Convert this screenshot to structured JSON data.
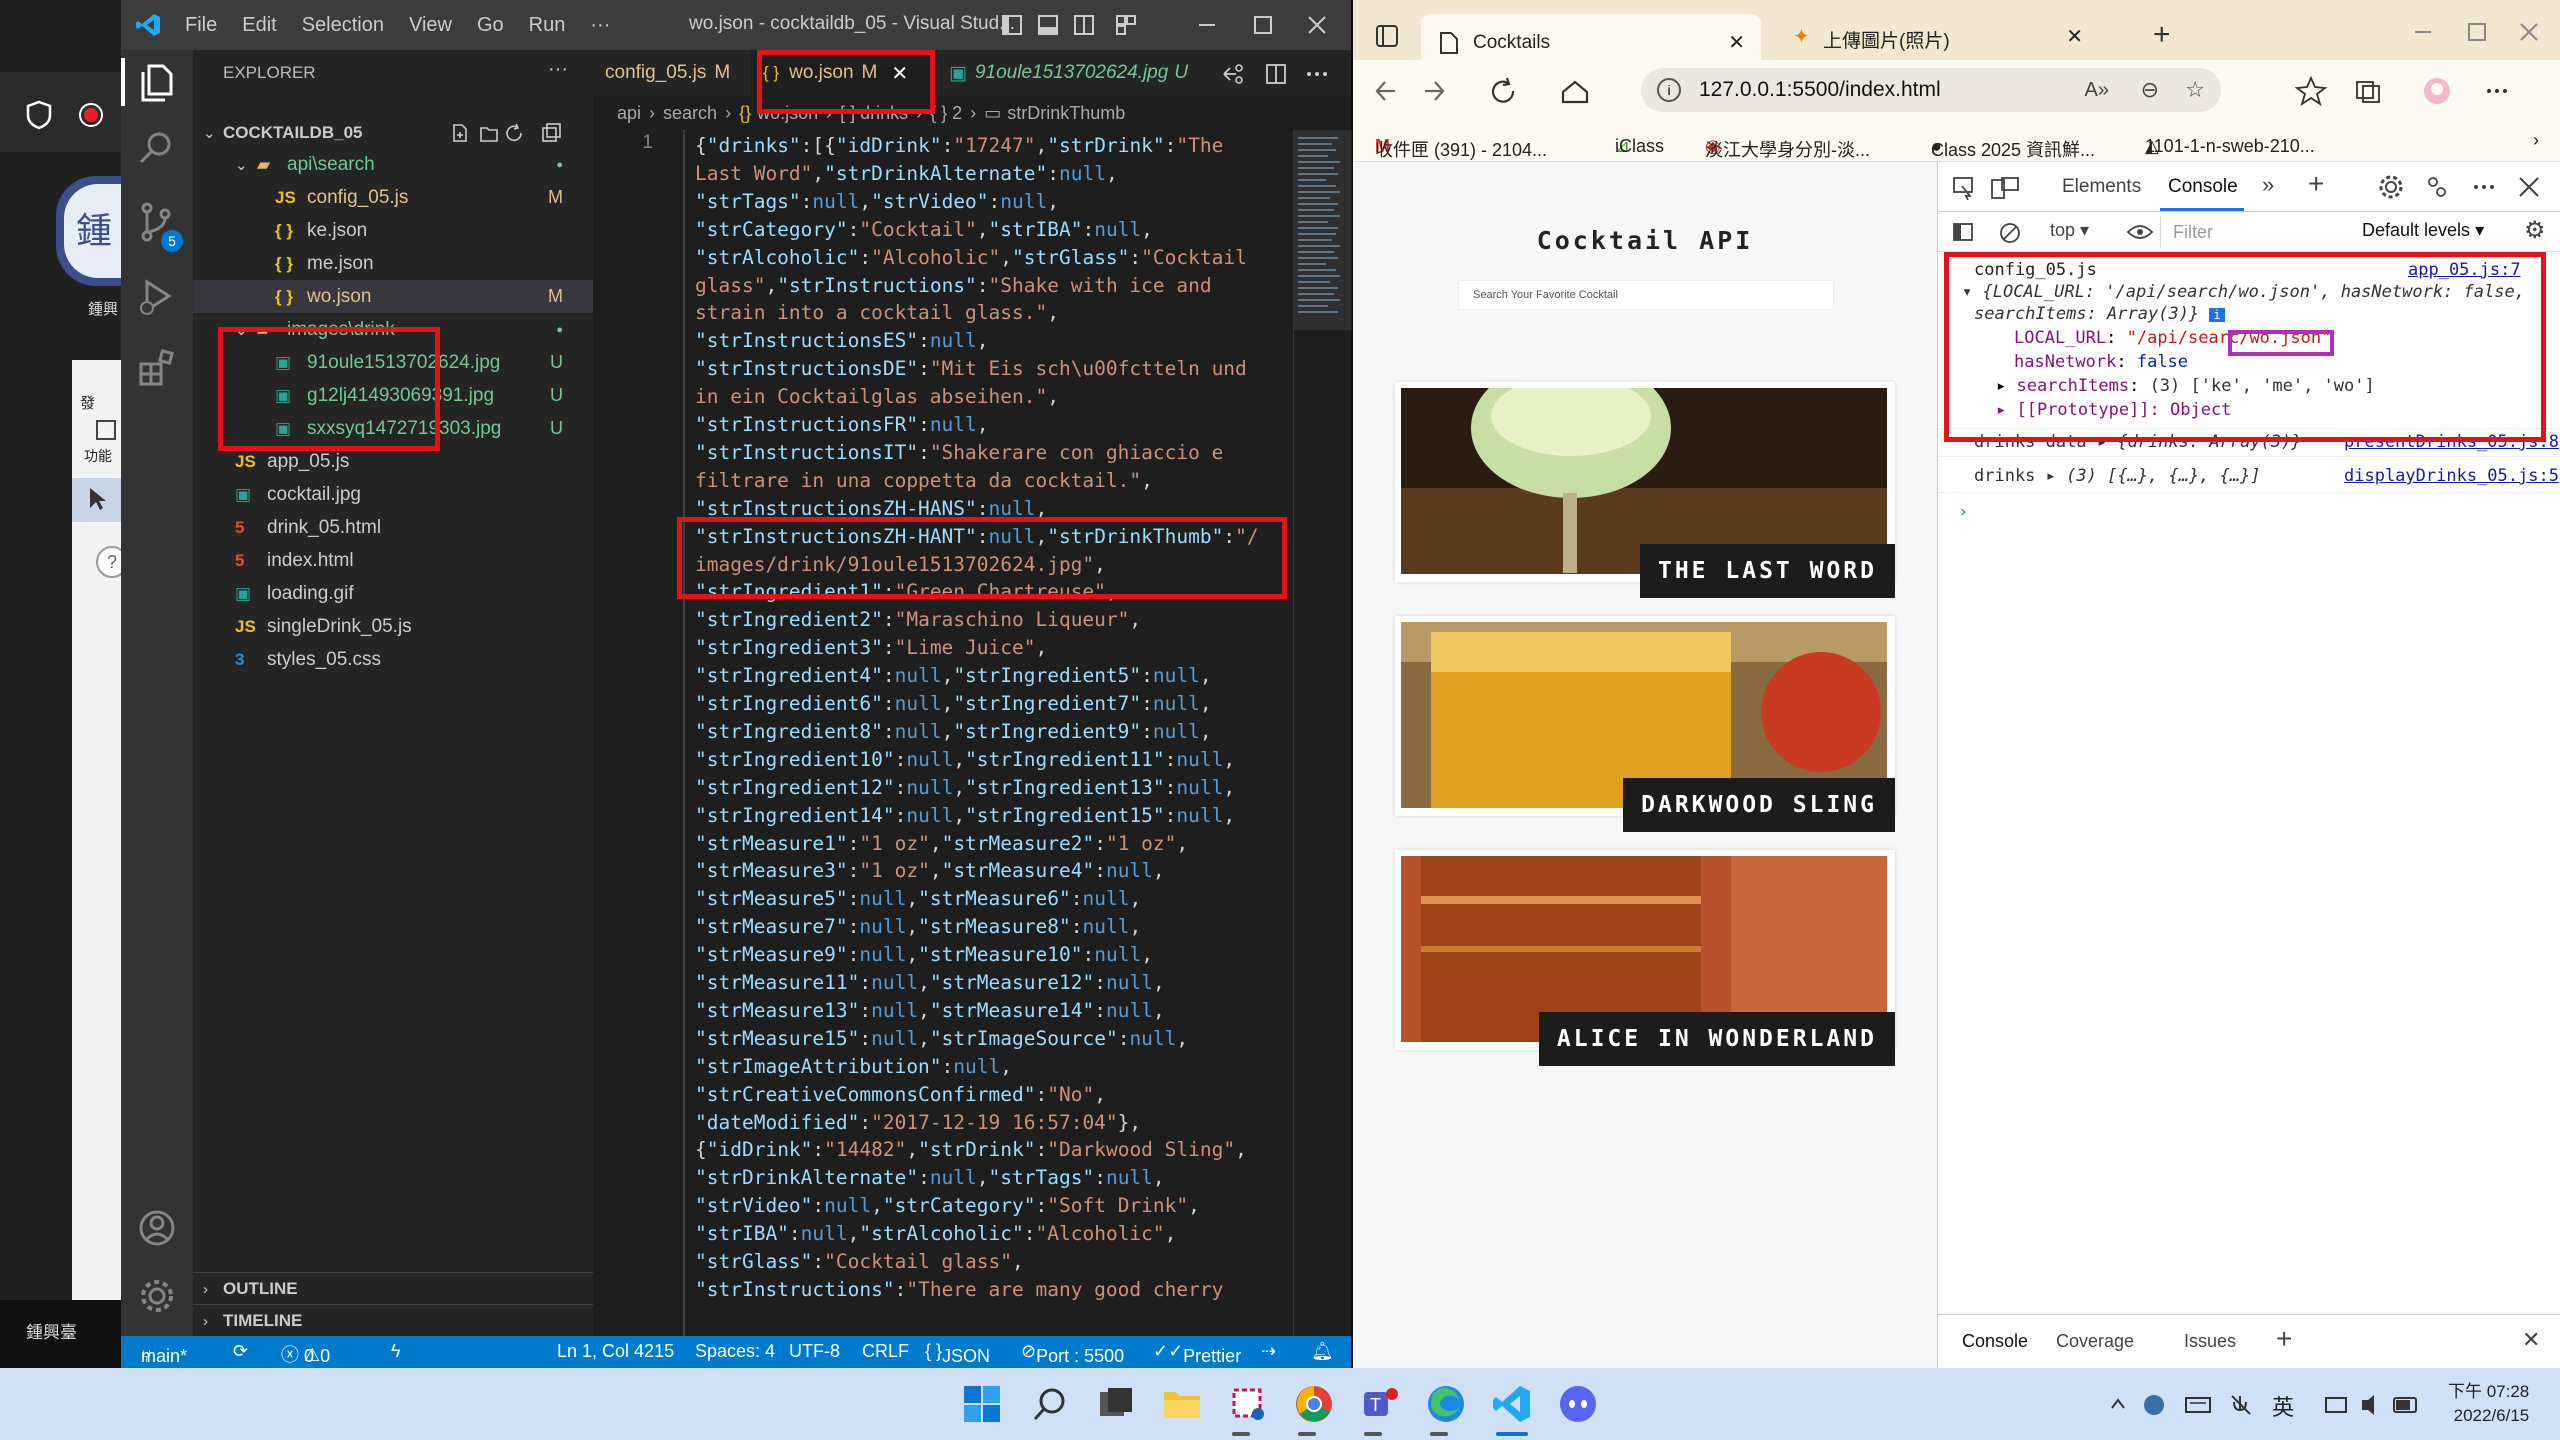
{
  "bgapp": {
    "char": "鍾",
    "small_label": "鍾興",
    "menu_label": "發",
    "func_label": "功能",
    "bottom_label": "鍾興臺"
  },
  "vscode": {
    "menu": [
      "File",
      "Edit",
      "Selection",
      "View",
      "Go",
      "Run",
      "···"
    ],
    "window_title": "wo.json - cocktaildb_05 - Visual Stud...",
    "scm_badge": "5",
    "explorer": {
      "header": "EXPLORER",
      "root": "COCKTAILDB_05",
      "items": [
        {
          "name": "api\\search",
          "type": "folder",
          "status": "●"
        },
        {
          "name": "config_05.js",
          "type": "js",
          "status": "M"
        },
        {
          "name": "ke.json",
          "type": "json",
          "status": ""
        },
        {
          "name": "me.json",
          "type": "json",
          "status": ""
        },
        {
          "name": "wo.json",
          "type": "json",
          "status": "M"
        },
        {
          "name": "images\\drink",
          "type": "folder",
          "status": "●"
        },
        {
          "name": "91oule1513702624.jpg",
          "type": "img",
          "status": "U"
        },
        {
          "name": "g12lj41493069391.jpg",
          "type": "img",
          "status": "U"
        },
        {
          "name": "sxxsyq1472719303.jpg",
          "type": "img",
          "status": "U"
        },
        {
          "name": "app_05.js",
          "type": "js",
          "status": ""
        },
        {
          "name": "cocktail.jpg",
          "type": "img",
          "status": ""
        },
        {
          "name": "drink_05.html",
          "type": "html",
          "status": ""
        },
        {
          "name": "index.html",
          "type": "html",
          "status": ""
        },
        {
          "name": "loading.gif",
          "type": "img",
          "status": ""
        },
        {
          "name": "singleDrink_05.js",
          "type": "js",
          "status": ""
        },
        {
          "name": "styles_05.css",
          "type": "css",
          "status": ""
        }
      ],
      "outline": "OUTLINE",
      "timeline": "TIMELINE"
    },
    "tabs": [
      {
        "label": "config_05.js",
        "status": "M"
      },
      {
        "label": "wo.json",
        "status": "M"
      },
      {
        "label": "91oule1513702624.jpg",
        "status": "U"
      }
    ],
    "breadcrumb": [
      "api",
      "search",
      "wo.json",
      "[ ] drinks",
      "{ } 2",
      "strDrinkThumb"
    ],
    "line_number": "1",
    "code": [
      [
        [
          "p",
          "{"
        ],
        [
          "k",
          "\"drinks\""
        ],
        [
          "p",
          ":[{"
        ],
        [
          "k",
          "\"idDrink\""
        ],
        [
          "p",
          ":"
        ],
        [
          "s",
          "\"17247\""
        ],
        [
          "p",
          ","
        ],
        [
          "k",
          "\"strDrink\""
        ],
        [
          "p",
          ":"
        ],
        [
          "s",
          "\"The"
        ]
      ],
      [
        [
          "s",
          "Last Word\""
        ],
        [
          "p",
          ","
        ],
        [
          "k",
          "\"strDrinkAlternate\""
        ],
        [
          "p",
          ":"
        ],
        [
          "n",
          "null"
        ],
        [
          "p",
          ","
        ]
      ],
      [
        [
          "k",
          "\"strTags\""
        ],
        [
          "p",
          ":"
        ],
        [
          "n",
          "null"
        ],
        [
          "p",
          ","
        ],
        [
          "k",
          "\"strVideo\""
        ],
        [
          "p",
          ":"
        ],
        [
          "n",
          "null"
        ],
        [
          "p",
          ","
        ]
      ],
      [
        [
          "k",
          "\"strCategory\""
        ],
        [
          "p",
          ":"
        ],
        [
          "s",
          "\"Cocktail\""
        ],
        [
          "p",
          ","
        ],
        [
          "k",
          "\"strIBA\""
        ],
        [
          "p",
          ":"
        ],
        [
          "n",
          "null"
        ],
        [
          "p",
          ","
        ]
      ],
      [
        [
          "k",
          "\"strAlcoholic\""
        ],
        [
          "p",
          ":"
        ],
        [
          "s",
          "\"Alcoholic\""
        ],
        [
          "p",
          ","
        ],
        [
          "k",
          "\"strGlass\""
        ],
        [
          "p",
          ":"
        ],
        [
          "s",
          "\"Cocktail"
        ]
      ],
      [
        [
          "s",
          "glass\""
        ],
        [
          "p",
          ","
        ],
        [
          "k",
          "\"strInstructions\""
        ],
        [
          "p",
          ":"
        ],
        [
          "s",
          "\"Shake with ice and"
        ]
      ],
      [
        [
          "s",
          "strain into a cocktail glass.\""
        ],
        [
          "p",
          ","
        ]
      ],
      [
        [
          "k",
          "\"strInstructionsES\""
        ],
        [
          "p",
          ":"
        ],
        [
          "n",
          "null"
        ],
        [
          "p",
          ","
        ]
      ],
      [
        [
          "k",
          "\"strInstructionsDE\""
        ],
        [
          "p",
          ":"
        ],
        [
          "s",
          "\"Mit Eis sch\\u00fctteln und"
        ]
      ],
      [
        [
          "s",
          "in ein Cocktailglas abseihen.\""
        ],
        [
          "p",
          ","
        ]
      ],
      [
        [
          "k",
          "\"strInstructionsFR\""
        ],
        [
          "p",
          ":"
        ],
        [
          "n",
          "null"
        ],
        [
          "p",
          ","
        ]
      ],
      [
        [
          "k",
          "\"strInstructionsIT\""
        ],
        [
          "p",
          ":"
        ],
        [
          "s",
          "\"Shakerare con ghiaccio e"
        ]
      ],
      [
        [
          "s",
          "filtrare in una coppetta da cocktail.\""
        ],
        [
          "p",
          ","
        ]
      ],
      [
        [
          "k",
          "\"strInstructionsZH-HANS\""
        ],
        [
          "p",
          ":"
        ],
        [
          "n",
          "null"
        ],
        [
          "p",
          ","
        ]
      ],
      [
        [
          "k",
          "\"strInstructionsZH-HANT\""
        ],
        [
          "p",
          ":"
        ],
        [
          "n",
          "null"
        ],
        [
          "p",
          ","
        ],
        [
          "k",
          "\"strDrinkThumb\""
        ],
        [
          "p",
          ":"
        ],
        [
          "s",
          "\"/"
        ]
      ],
      [
        [
          "s",
          "images/drink/91oule1513702624.jpg\""
        ],
        [
          "p",
          ","
        ]
      ],
      [
        [
          "k",
          "\"strIngredient1\""
        ],
        [
          "p",
          ":"
        ],
        [
          "s",
          "\"Green Chartreuse\""
        ],
        [
          "p",
          ","
        ]
      ],
      [
        [
          "k",
          "\"strIngredient2\""
        ],
        [
          "p",
          ":"
        ],
        [
          "s",
          "\"Maraschino Liqueur\""
        ],
        [
          "p",
          ","
        ]
      ],
      [
        [
          "k",
          "\"strIngredient3\""
        ],
        [
          "p",
          ":"
        ],
        [
          "s",
          "\"Lime Juice\""
        ],
        [
          "p",
          ","
        ]
      ],
      [
        [
          "k",
          "\"strIngredient4\""
        ],
        [
          "p",
          ":"
        ],
        [
          "n",
          "null"
        ],
        [
          "p",
          ","
        ],
        [
          "k",
          "\"strIngredient5\""
        ],
        [
          "p",
          ":"
        ],
        [
          "n",
          "null"
        ],
        [
          "p",
          ","
        ]
      ],
      [
        [
          "k",
          "\"strIngredient6\""
        ],
        [
          "p",
          ":"
        ],
        [
          "n",
          "null"
        ],
        [
          "p",
          ","
        ],
        [
          "k",
          "\"strIngredient7\""
        ],
        [
          "p",
          ":"
        ],
        [
          "n",
          "null"
        ],
        [
          "p",
          ","
        ]
      ],
      [
        [
          "k",
          "\"strIngredient8\""
        ],
        [
          "p",
          ":"
        ],
        [
          "n",
          "null"
        ],
        [
          "p",
          ","
        ],
        [
          "k",
          "\"strIngredient9\""
        ],
        [
          "p",
          ":"
        ],
        [
          "n",
          "null"
        ],
        [
          "p",
          ","
        ]
      ],
      [
        [
          "k",
          "\"strIngredient10\""
        ],
        [
          "p",
          ":"
        ],
        [
          "n",
          "null"
        ],
        [
          "p",
          ","
        ],
        [
          "k",
          "\"strIngredient11\""
        ],
        [
          "p",
          ":"
        ],
        [
          "n",
          "null"
        ],
        [
          "p",
          ","
        ]
      ],
      [
        [
          "k",
          "\"strIngredient12\""
        ],
        [
          "p",
          ":"
        ],
        [
          "n",
          "null"
        ],
        [
          "p",
          ","
        ],
        [
          "k",
          "\"strIngredient13\""
        ],
        [
          "p",
          ":"
        ],
        [
          "n",
          "null"
        ],
        [
          "p",
          ","
        ]
      ],
      [
        [
          "k",
          "\"strIngredient14\""
        ],
        [
          "p",
          ":"
        ],
        [
          "n",
          "null"
        ],
        [
          "p",
          ","
        ],
        [
          "k",
          "\"strIngredient15\""
        ],
        [
          "p",
          ":"
        ],
        [
          "n",
          "null"
        ],
        [
          "p",
          ","
        ]
      ],
      [
        [
          "k",
          "\"strMeasure1\""
        ],
        [
          "p",
          ":"
        ],
        [
          "s",
          "\"1 oz\""
        ],
        [
          "p",
          ","
        ],
        [
          "k",
          "\"strMeasure2\""
        ],
        [
          "p",
          ":"
        ],
        [
          "s",
          "\"1 oz\""
        ],
        [
          "p",
          ","
        ]
      ],
      [
        [
          "k",
          "\"strMeasure3\""
        ],
        [
          "p",
          ":"
        ],
        [
          "s",
          "\"1 oz\""
        ],
        [
          "p",
          ","
        ],
        [
          "k",
          "\"strMeasure4\""
        ],
        [
          "p",
          ":"
        ],
        [
          "n",
          "null"
        ],
        [
          "p",
          ","
        ]
      ],
      [
        [
          "k",
          "\"strMeasure5\""
        ],
        [
          "p",
          ":"
        ],
        [
          "n",
          "null"
        ],
        [
          "p",
          ","
        ],
        [
          "k",
          "\"strMeasure6\""
        ],
        [
          "p",
          ":"
        ],
        [
          "n",
          "null"
        ],
        [
          "p",
          ","
        ]
      ],
      [
        [
          "k",
          "\"strMeasure7\""
        ],
        [
          "p",
          ":"
        ],
        [
          "n",
          "null"
        ],
        [
          "p",
          ","
        ],
        [
          "k",
          "\"strMeasure8\""
        ],
        [
          "p",
          ":"
        ],
        [
          "n",
          "null"
        ],
        [
          "p",
          ","
        ]
      ],
      [
        [
          "k",
          "\"strMeasure9\""
        ],
        [
          "p",
          ":"
        ],
        [
          "n",
          "null"
        ],
        [
          "p",
          ","
        ],
        [
          "k",
          "\"strMeasure10\""
        ],
        [
          "p",
          ":"
        ],
        [
          "n",
          "null"
        ],
        [
          "p",
          ","
        ]
      ],
      [
        [
          "k",
          "\"strMeasure11\""
        ],
        [
          "p",
          ":"
        ],
        [
          "n",
          "null"
        ],
        [
          "p",
          ","
        ],
        [
          "k",
          "\"strMeasure12\""
        ],
        [
          "p",
          ":"
        ],
        [
          "n",
          "null"
        ],
        [
          "p",
          ","
        ]
      ],
      [
        [
          "k",
          "\"strMeasure13\""
        ],
        [
          "p",
          ":"
        ],
        [
          "n",
          "null"
        ],
        [
          "p",
          ","
        ],
        [
          "k",
          "\"strMeasure14\""
        ],
        [
          "p",
          ":"
        ],
        [
          "n",
          "null"
        ],
        [
          "p",
          ","
        ]
      ],
      [
        [
          "k",
          "\"strMeasure15\""
        ],
        [
          "p",
          ":"
        ],
        [
          "n",
          "null"
        ],
        [
          "p",
          ","
        ],
        [
          "k",
          "\"strImageSource\""
        ],
        [
          "p",
          ":"
        ],
        [
          "n",
          "null"
        ],
        [
          "p",
          ","
        ]
      ],
      [
        [
          "k",
          "\"strImageAttribution\""
        ],
        [
          "p",
          ":"
        ],
        [
          "n",
          "null"
        ],
        [
          "p",
          ","
        ]
      ],
      [
        [
          "k",
          "\"strCreativeCommonsConfirmed\""
        ],
        [
          "p",
          ":"
        ],
        [
          "s",
          "\"No\""
        ],
        [
          "p",
          ","
        ]
      ],
      [
        [
          "k",
          "\"dateModified\""
        ],
        [
          "p",
          ":"
        ],
        [
          "s",
          "\"2017-12-19 16:57:04\""
        ],
        [
          "p",
          "},"
        ]
      ],
      [
        [
          "p",
          "{"
        ],
        [
          "k",
          "\"idDrink\""
        ],
        [
          "p",
          ":"
        ],
        [
          "s",
          "\"14482\""
        ],
        [
          "p",
          ","
        ],
        [
          "k",
          "\"strDrink\""
        ],
        [
          "p",
          ":"
        ],
        [
          "s",
          "\"Darkwood Sling\""
        ],
        [
          "p",
          ","
        ]
      ],
      [
        [
          "k",
          "\"strDrinkAlternate\""
        ],
        [
          "p",
          ":"
        ],
        [
          "n",
          "null"
        ],
        [
          "p",
          ","
        ],
        [
          "k",
          "\"strTags\""
        ],
        [
          "p",
          ":"
        ],
        [
          "n",
          "null"
        ],
        [
          "p",
          ","
        ]
      ],
      [
        [
          "k",
          "\"strVideo\""
        ],
        [
          "p",
          ":"
        ],
        [
          "n",
          "null"
        ],
        [
          "p",
          ","
        ],
        [
          "k",
          "\"strCategory\""
        ],
        [
          "p",
          ":"
        ],
        [
          "s",
          "\"Soft Drink\""
        ],
        [
          "p",
          ","
        ]
      ],
      [
        [
          "k",
          "\"strIBA\""
        ],
        [
          "p",
          ":"
        ],
        [
          "n",
          "null"
        ],
        [
          "p",
          ","
        ],
        [
          "k",
          "\"strAlcoholic\""
        ],
        [
          "p",
          ":"
        ],
        [
          "s",
          "\"Alcoholic\""
        ],
        [
          "p",
          ","
        ]
      ],
      [
        [
          "k",
          "\"strGlass\""
        ],
        [
          "p",
          ":"
        ],
        [
          "s",
          "\"Cocktail glass\""
        ],
        [
          "p",
          ","
        ]
      ],
      [
        [
          "k",
          "\"strInstructions\""
        ],
        [
          "p",
          ":"
        ],
        [
          "s",
          "\"There are many good cherry"
        ]
      ]
    ],
    "status_bar": {
      "branch": "main*",
      "errors": "0",
      "warnings": "0",
      "position": "Ln 1, Col 4215",
      "spaces": "Spaces: 4",
      "encoding": "UTF-8",
      "eol": "CRLF",
      "language": "JSON",
      "port": "Port : 5500",
      "prettier": "Prettier"
    }
  },
  "browser": {
    "tabs": [
      {
        "label": "Cocktails"
      },
      {
        "label": "上傳圖片(照片)"
      }
    ],
    "url": "127.0.0.1:5500/index.html",
    "bookmarks": [
      "收件匣 (391) - 2104...",
      "iClass",
      "淡江大學身分別-淡...",
      "Class 2025 資訊鮮...",
      "1101-1-n-sweb-210..."
    ],
    "page": {
      "title": "Cocktail API",
      "search_placeholder": "Search Your Favorite Cocktail",
      "drinks": [
        {
          "name": "THE LAST WORD"
        },
        {
          "name": "DARKWOOD SLING"
        },
        {
          "name": "ALICE IN WONDERLAND"
        }
      ]
    },
    "devtools": {
      "tabs": [
        "Elements",
        "Console"
      ],
      "context": "top",
      "filter_placeholder": "Filter",
      "levels": "Default levels",
      "console": {
        "log1_label": "config_05.js",
        "log1_source": "app_05.js:7",
        "log1_summary1": "{LOCAL_URL: '/api/search/wo.json', hasNetwork: false,",
        "log1_summary2": "searchItems: Array(3)}",
        "local_url_key": "LOCAL_URL",
        "local_url_val_a": "\"/api/searc",
        "local_url_val_b": "/wo.json\"",
        "has_network_key": "hasNetwork",
        "has_network_val": "false",
        "search_items_key": "searchItems",
        "search_items_val": "(3) ['ke', 'me', 'wo']",
        "prototype": "[[Prototype]]: Object",
        "log2_label": "drinks data",
        "log2_value": "{drinks: Array(3)}",
        "log2_source": "presentDrinks_05.js:8",
        "log3_label": "drinks",
        "log3_value": "(3) [{…}, {…}, {…}]",
        "log3_source": "displayDrinks_05.js:5"
      },
      "bottom_tabs": [
        "Console",
        "Coverage",
        "Issues"
      ]
    }
  },
  "taskbar": {
    "lang": "英",
    "time_line1": "下午 07:28",
    "time_line2": "2022/6/15"
  }
}
